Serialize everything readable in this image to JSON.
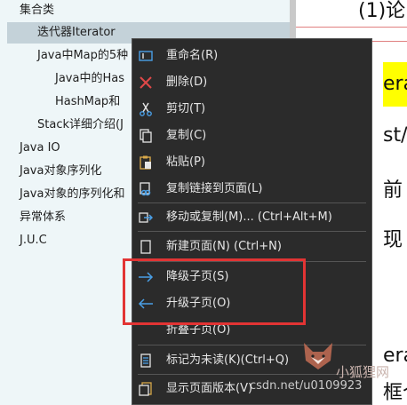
{
  "tree": {
    "items": [
      {
        "label": "集合类"
      },
      {
        "label": "迭代器Iterator"
      },
      {
        "label": "Java中Map的5种"
      },
      {
        "label": "Java中的Has"
      },
      {
        "label": "HashMap和"
      },
      {
        "label": "Stack详细介绍(J"
      },
      {
        "label": "Java IO"
      },
      {
        "label": "Java对象序列化"
      },
      {
        "label": "Java对象的序列化和"
      },
      {
        "label": "异常体系"
      },
      {
        "label": "J.U.C"
      }
    ]
  },
  "page": {
    "fragments": [
      "(1)论",
      "era",
      "st/",
      "前",
      "现",
      "era",
      "框个"
    ]
  },
  "menu": {
    "items": [
      {
        "label": "重命名(R)",
        "icon": "rename-icon"
      },
      {
        "label": "删除(D)",
        "icon": "delete-x-icon"
      },
      {
        "label": "剪切(T)",
        "icon": "scissors-icon"
      },
      {
        "label": "复制(C)",
        "icon": "copy-icon"
      },
      {
        "label": "粘贴(P)",
        "icon": "paste-icon"
      },
      {
        "label": "复制链接到页面(L)",
        "icon": "link-icon"
      },
      {
        "label": "移动或复制(M)...  (Ctrl+Alt+M)",
        "icon": "move-icon"
      },
      {
        "label": "新建页面(N)  (Ctrl+N)",
        "icon": "new-page-icon"
      },
      {
        "label": "降级子页(S)",
        "icon": "arrow-right-icon"
      },
      {
        "label": "升级子页(O)",
        "icon": "arrow-left-icon"
      },
      {
        "label": "折叠子页(O)",
        "icon": ""
      },
      {
        "label": "标记为未读(K)(Ctrl+Q)",
        "icon": "mark-unread-icon"
      },
      {
        "label": "显示页面版本(V)",
        "icon": "page-version-icon"
      }
    ]
  },
  "watermark": {
    "text": "csdn.net/u0109923",
    "brand": "小狐狸网"
  },
  "colors": {
    "menu_bg": "#2b2b2b",
    "callout": "#e23434",
    "accent_blue": "#4a9fe6",
    "delete_red": "#e04848"
  }
}
